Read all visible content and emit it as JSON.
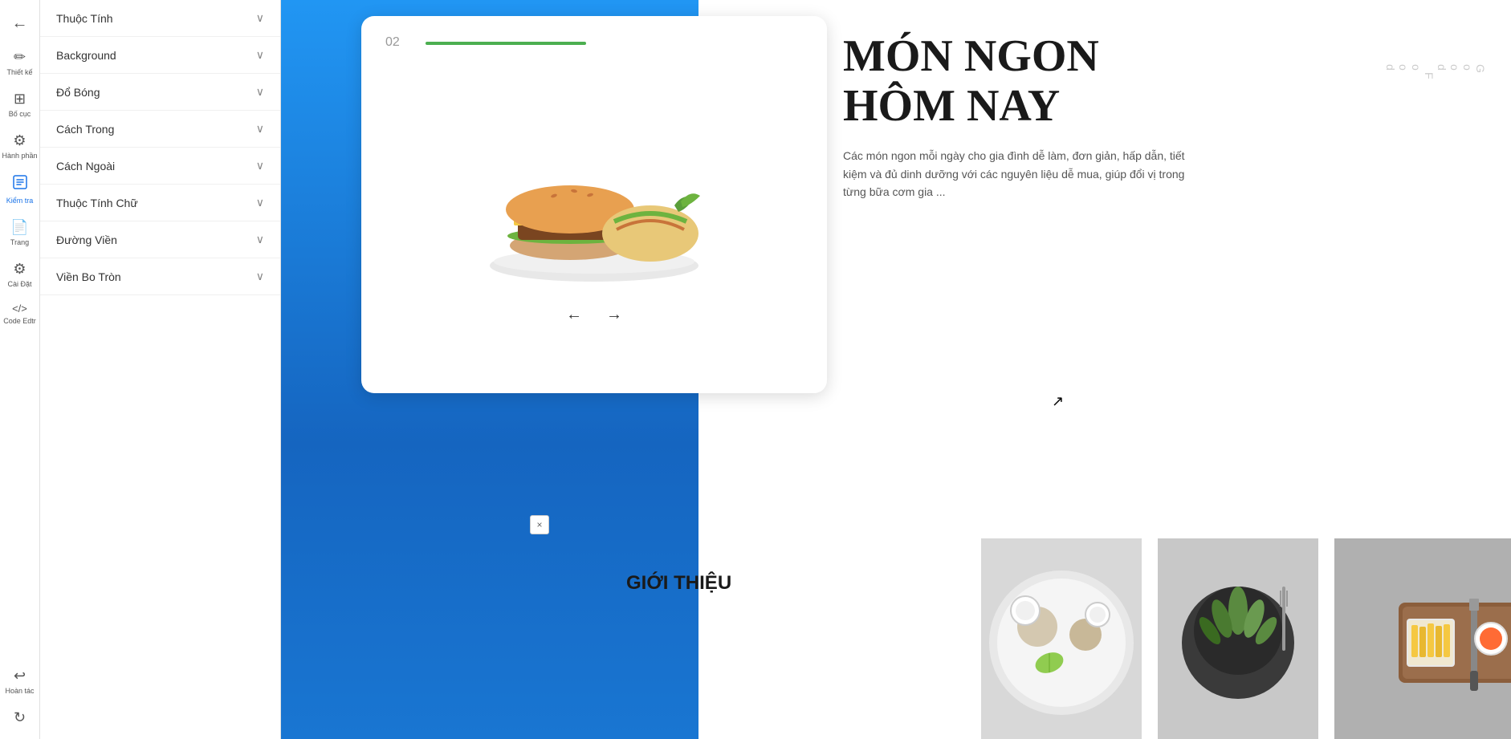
{
  "toolbar": {
    "back_icon": "←",
    "items": [
      {
        "id": "thiet-ke",
        "label": "Thiết kế",
        "icon": "✏️"
      },
      {
        "id": "bo-cuc",
        "label": "Bố cục",
        "icon": "⊞"
      },
      {
        "id": "hanh-phan",
        "label": "Hành phần",
        "icon": "⚙"
      },
      {
        "id": "kiem-tra",
        "label": "Kiểm tra",
        "icon": "🔍",
        "active": true
      },
      {
        "id": "trang",
        "label": "Trang",
        "icon": "📄"
      },
      {
        "id": "cai-dat",
        "label": "Cài Đặt",
        "icon": "⚙"
      },
      {
        "id": "code-edtr",
        "label": "Code Edtr",
        "icon": "<>"
      }
    ],
    "bottom_items": [
      {
        "id": "hoan-tac",
        "label": "Hoàn tác",
        "icon": "↩"
      },
      {
        "id": "refresh",
        "label": "",
        "icon": "↻"
      }
    ]
  },
  "sidebar": {
    "items": [
      {
        "id": "thuoc-tinh",
        "label": "Thuộc Tính"
      },
      {
        "id": "background",
        "label": "Background"
      },
      {
        "id": "do-bong",
        "label": "Đổ Bóng"
      },
      {
        "id": "cach-trong",
        "label": "Cách Trong"
      },
      {
        "id": "cach-ngoai",
        "label": "Cách Ngoài"
      },
      {
        "id": "thuoc-tinh-chu",
        "label": "Thuộc Tính Chữ"
      },
      {
        "id": "duong-vien",
        "label": "Đường Viền"
      },
      {
        "id": "vien-bo-tron",
        "label": "Viền Bo Tròn"
      }
    ],
    "chevron": "∨"
  },
  "preview": {
    "slide_number": "02",
    "slide_line_color": "#4CAF50",
    "title_line1": "MÓN NGON",
    "title_line2": "HÔM NAY",
    "description": "Các món ngon mỗi ngày cho gia đình dễ làm, đơn giản, hấp dẫn, tiết kiệm và đủ dinh dưỡng với các nguyên liệu dễ mua, giúp đổi vị trong từng bữa cơm gia ...",
    "nav_left": "←",
    "nav_right": "→",
    "vertical_text": "G o o d F o o d",
    "bottom_intro": "GIỚI THIỆU",
    "x_button": "×"
  }
}
